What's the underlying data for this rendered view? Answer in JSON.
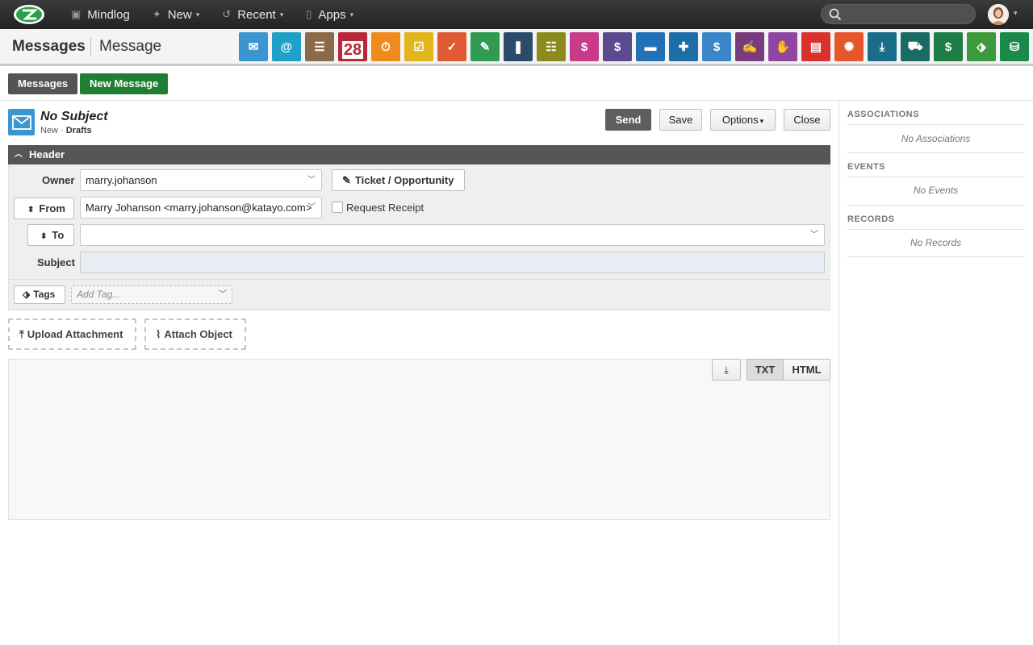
{
  "topnav": {
    "items": [
      {
        "label": "Mindlog",
        "icon": "computer-icon",
        "has_menu": false
      },
      {
        "label": "New",
        "icon": "sparkle-icon",
        "has_menu": true
      },
      {
        "label": "Recent",
        "icon": "history-icon",
        "has_menu": true
      },
      {
        "label": "Apps",
        "icon": "tablet-icon",
        "has_menu": true
      }
    ],
    "search_placeholder": ""
  },
  "appbar": {
    "title": "Messages",
    "subtitle": "Message",
    "apps": [
      {
        "name": "messages",
        "color": "#3a95d0",
        "icon": "envelope-icon"
      },
      {
        "name": "email",
        "color": "#1fa0c7",
        "icon": "address-book-icon"
      },
      {
        "name": "contacts",
        "color": "#8a6a48",
        "icon": "contacts-icon"
      },
      {
        "name": "calendar",
        "color": "#b92636",
        "icon": "calendar-icon",
        "text": "28"
      },
      {
        "name": "timer",
        "color": "#ef8b1c",
        "icon": "stopwatch-icon"
      },
      {
        "name": "tasks",
        "color": "#e2b61a",
        "icon": "tasks-icon"
      },
      {
        "name": "projects",
        "color": "#e05a33",
        "icon": "folder-check-icon"
      },
      {
        "name": "notes",
        "color": "#2f9a52",
        "icon": "notes-icon"
      },
      {
        "name": "bookmarks",
        "color": "#2c4a6b",
        "icon": "bookmark-icon"
      },
      {
        "name": "docs",
        "color": "#8c8a1d",
        "icon": "document-icon"
      },
      {
        "name": "sales",
        "color": "#c93a8a",
        "icon": "register-icon"
      },
      {
        "name": "billing",
        "color": "#5a4a8e",
        "icon": "dollar-icon"
      },
      {
        "name": "shipping",
        "color": "#2270b5",
        "icon": "truck-icon"
      },
      {
        "name": "support",
        "color": "#1c6fa6",
        "icon": "lifebuoy-icon"
      },
      {
        "name": "finance",
        "color": "#3b86c9",
        "icon": "money-bag-icon"
      },
      {
        "name": "contracts",
        "color": "#7a3b7d",
        "icon": "contract-icon"
      },
      {
        "name": "deals",
        "color": "#8e46a0",
        "icon": "handshake-icon"
      },
      {
        "name": "pdf",
        "color": "#d9322c",
        "icon": "pdf-icon"
      },
      {
        "name": "broadcast",
        "color": "#e6562b",
        "icon": "broadcast-icon"
      },
      {
        "name": "downloads",
        "color": "#1b6b8a",
        "icon": "download-icon"
      },
      {
        "name": "inventory",
        "color": "#196b63",
        "icon": "cart-icon"
      },
      {
        "name": "cash",
        "color": "#1e7e46",
        "icon": "cash-icon"
      },
      {
        "name": "pricing",
        "color": "#3c9a3c",
        "icon": "tag-icon"
      },
      {
        "name": "database",
        "color": "#1a8a4a",
        "icon": "database-icon"
      }
    ]
  },
  "actions": {
    "messages_label": "Messages",
    "new_message_label": "New Message"
  },
  "message": {
    "title": "No Subject",
    "status_new": "New",
    "status_sep": " · ",
    "status_folder": "Drafts",
    "send_label": "Send",
    "save_label": "Save",
    "options_label": "Options",
    "close_label": "Close"
  },
  "header_section": {
    "title": "Header",
    "owner_label": "Owner",
    "owner_value": "marry.johanson",
    "ticket_label": "Ticket / Opportunity",
    "from_label": "From",
    "from_value": "Marry Johanson <marry.johanson@katayo.com>",
    "request_receipt_label": "Request Receipt",
    "to_label": "To",
    "to_value": "",
    "subject_label": "Subject",
    "subject_value": "",
    "tags_label": "Tags",
    "tag_placeholder": "Add Tag..."
  },
  "attachments": {
    "upload_label": "Upload Attachment",
    "attach_object_label": "Attach Object"
  },
  "editor": {
    "txt_label": "TXT",
    "html_label": "HTML",
    "active_mode": "TXT",
    "body": ""
  },
  "sidebar": {
    "associations_title": "ASSOCIATIONS",
    "associations_empty": "No Associations",
    "events_title": "EVENTS",
    "events_empty": "No Events",
    "records_title": "RECORDS",
    "records_empty": "No Records"
  }
}
